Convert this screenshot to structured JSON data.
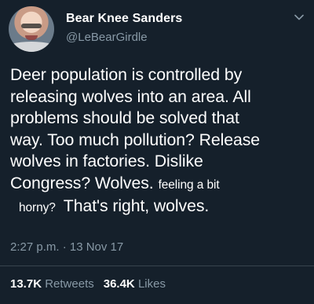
{
  "tweet": {
    "author": {
      "display_name": "Bear Knee Sanders",
      "handle": "@LeBearGirdle"
    },
    "text": {
      "line1": "Deer population is controlled by",
      "line2": "releasing wolves into an area. All",
      "line3": "problems should be solved that",
      "line4": "way. Too much pollution? Release",
      "line5": "wolves in factories. Dislike",
      "line6_main": "Congress? Wolves.",
      "line6_small": "feeling a bit",
      "line7_small": "horny?",
      "line7_main": "That's right, wolves."
    },
    "timestamp": "2:27 p.m. · 13 Nov 17",
    "stats": {
      "retweets_count": "13.7K",
      "retweets_label": "Retweets",
      "likes_count": "36.4K",
      "likes_label": "Likes"
    }
  },
  "icons": {
    "menu": "chevron-down-icon",
    "avatar": "profile-photo"
  },
  "colors": {
    "background": "#15202b",
    "primary_text": "#ffffff",
    "secondary_text": "#8899a6",
    "divider": "#38444d"
  }
}
